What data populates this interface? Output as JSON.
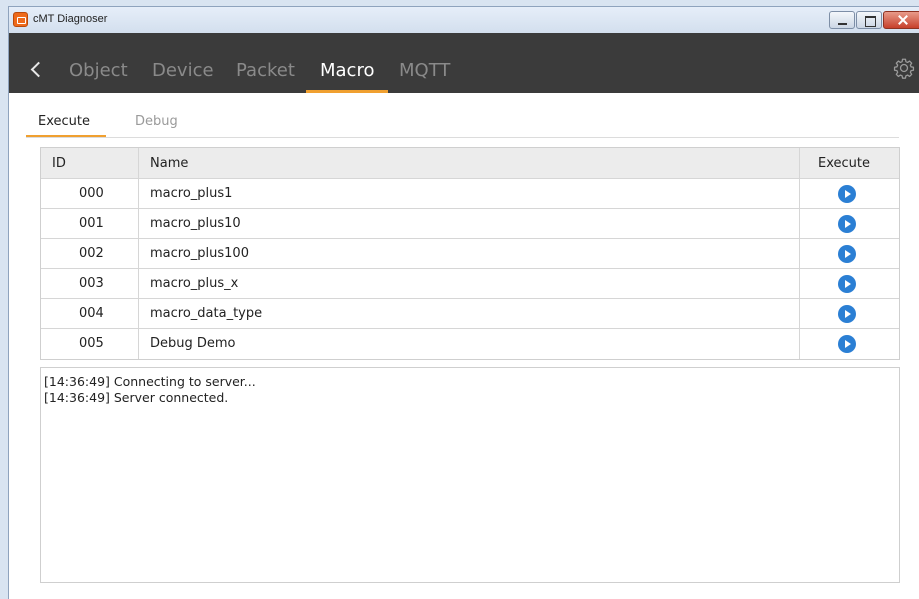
{
  "window": {
    "title": "cMT Diagnoser"
  },
  "nav": {
    "tabs": [
      {
        "label": "Object"
      },
      {
        "label": "Device"
      },
      {
        "label": "Packet"
      },
      {
        "label": "Macro"
      },
      {
        "label": "MQTT"
      }
    ],
    "active_tab": "Macro"
  },
  "subtabs": [
    {
      "label": "Execute"
    },
    {
      "label": "Debug"
    }
  ],
  "active_subtab": "Execute",
  "table": {
    "headers": {
      "id": "ID",
      "name": "Name",
      "execute": "Execute"
    },
    "rows": [
      {
        "id": "000",
        "name": "macro_plus1"
      },
      {
        "id": "001",
        "name": "macro_plus10"
      },
      {
        "id": "002",
        "name": "macro_plus100"
      },
      {
        "id": "003",
        "name": "macro_plus_x"
      },
      {
        "id": "004",
        "name": "macro_data_type"
      },
      {
        "id": "005",
        "name": "Debug Demo"
      }
    ]
  },
  "log": {
    "lines": [
      "[14:36:49] Connecting to server...",
      "[14:36:49] Server connected."
    ]
  },
  "colors": {
    "accent": "#f0a030",
    "play_button": "#2b7fd4",
    "navbar": "#3b3b3b"
  },
  "icons": {
    "back": "chevron-left-icon",
    "settings": "gear-icon",
    "execute": "play-circle-icon"
  }
}
